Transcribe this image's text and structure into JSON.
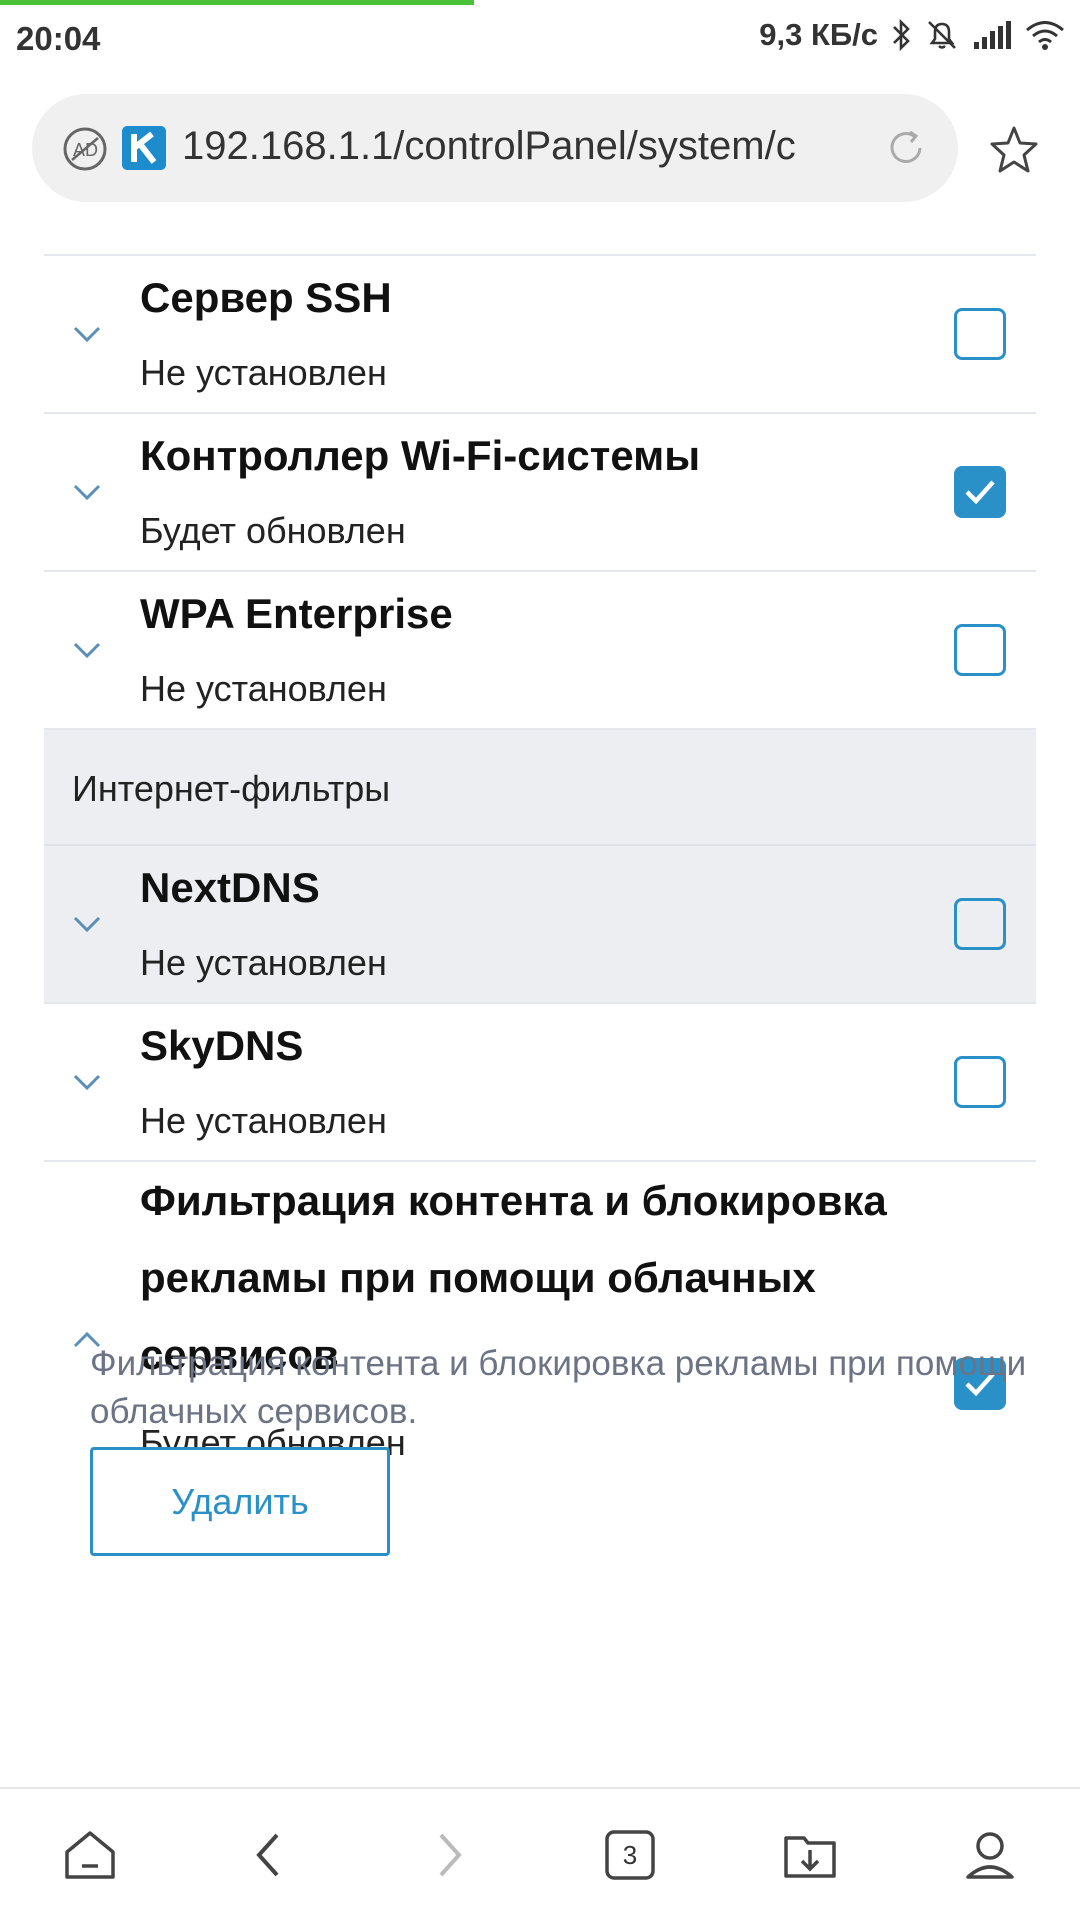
{
  "status_bar": {
    "time": "20:04",
    "speed": "9,3 КБ/с"
  },
  "address_bar": {
    "url": "192.168.1.1/controlPanel/system/c"
  },
  "components": [
    {
      "title": "Сервер SSH",
      "status": "Не установлен",
      "checked": false
    },
    {
      "title": "Контроллер Wi-Fi-системы",
      "status": "Будет обновлен",
      "checked": true
    },
    {
      "title": "WPA Enterprise",
      "status": "Не установлен",
      "checked": false
    }
  ],
  "section": {
    "label": "Интернет-фильтры"
  },
  "filters": [
    {
      "title": "NextDNS",
      "status": "Не установлен",
      "checked": false
    },
    {
      "title": "SkyDNS",
      "status": "Не установлен",
      "checked": false
    },
    {
      "title": "Фильтрация контента и блокировка рекламы при помощи облачных сервисов",
      "status": "Будет обновлен",
      "checked": true
    }
  ],
  "expanded": {
    "description": "Фильтрация контента и блокировка рекламы при помощи облачных сервисов.",
    "delete_label": "Удалить"
  },
  "bottom_nav": {
    "tab_count": "3"
  },
  "colors": {
    "accent": "#2a90c8",
    "progress": "#4cc23a",
    "highlight_bg": "#eceef1"
  }
}
